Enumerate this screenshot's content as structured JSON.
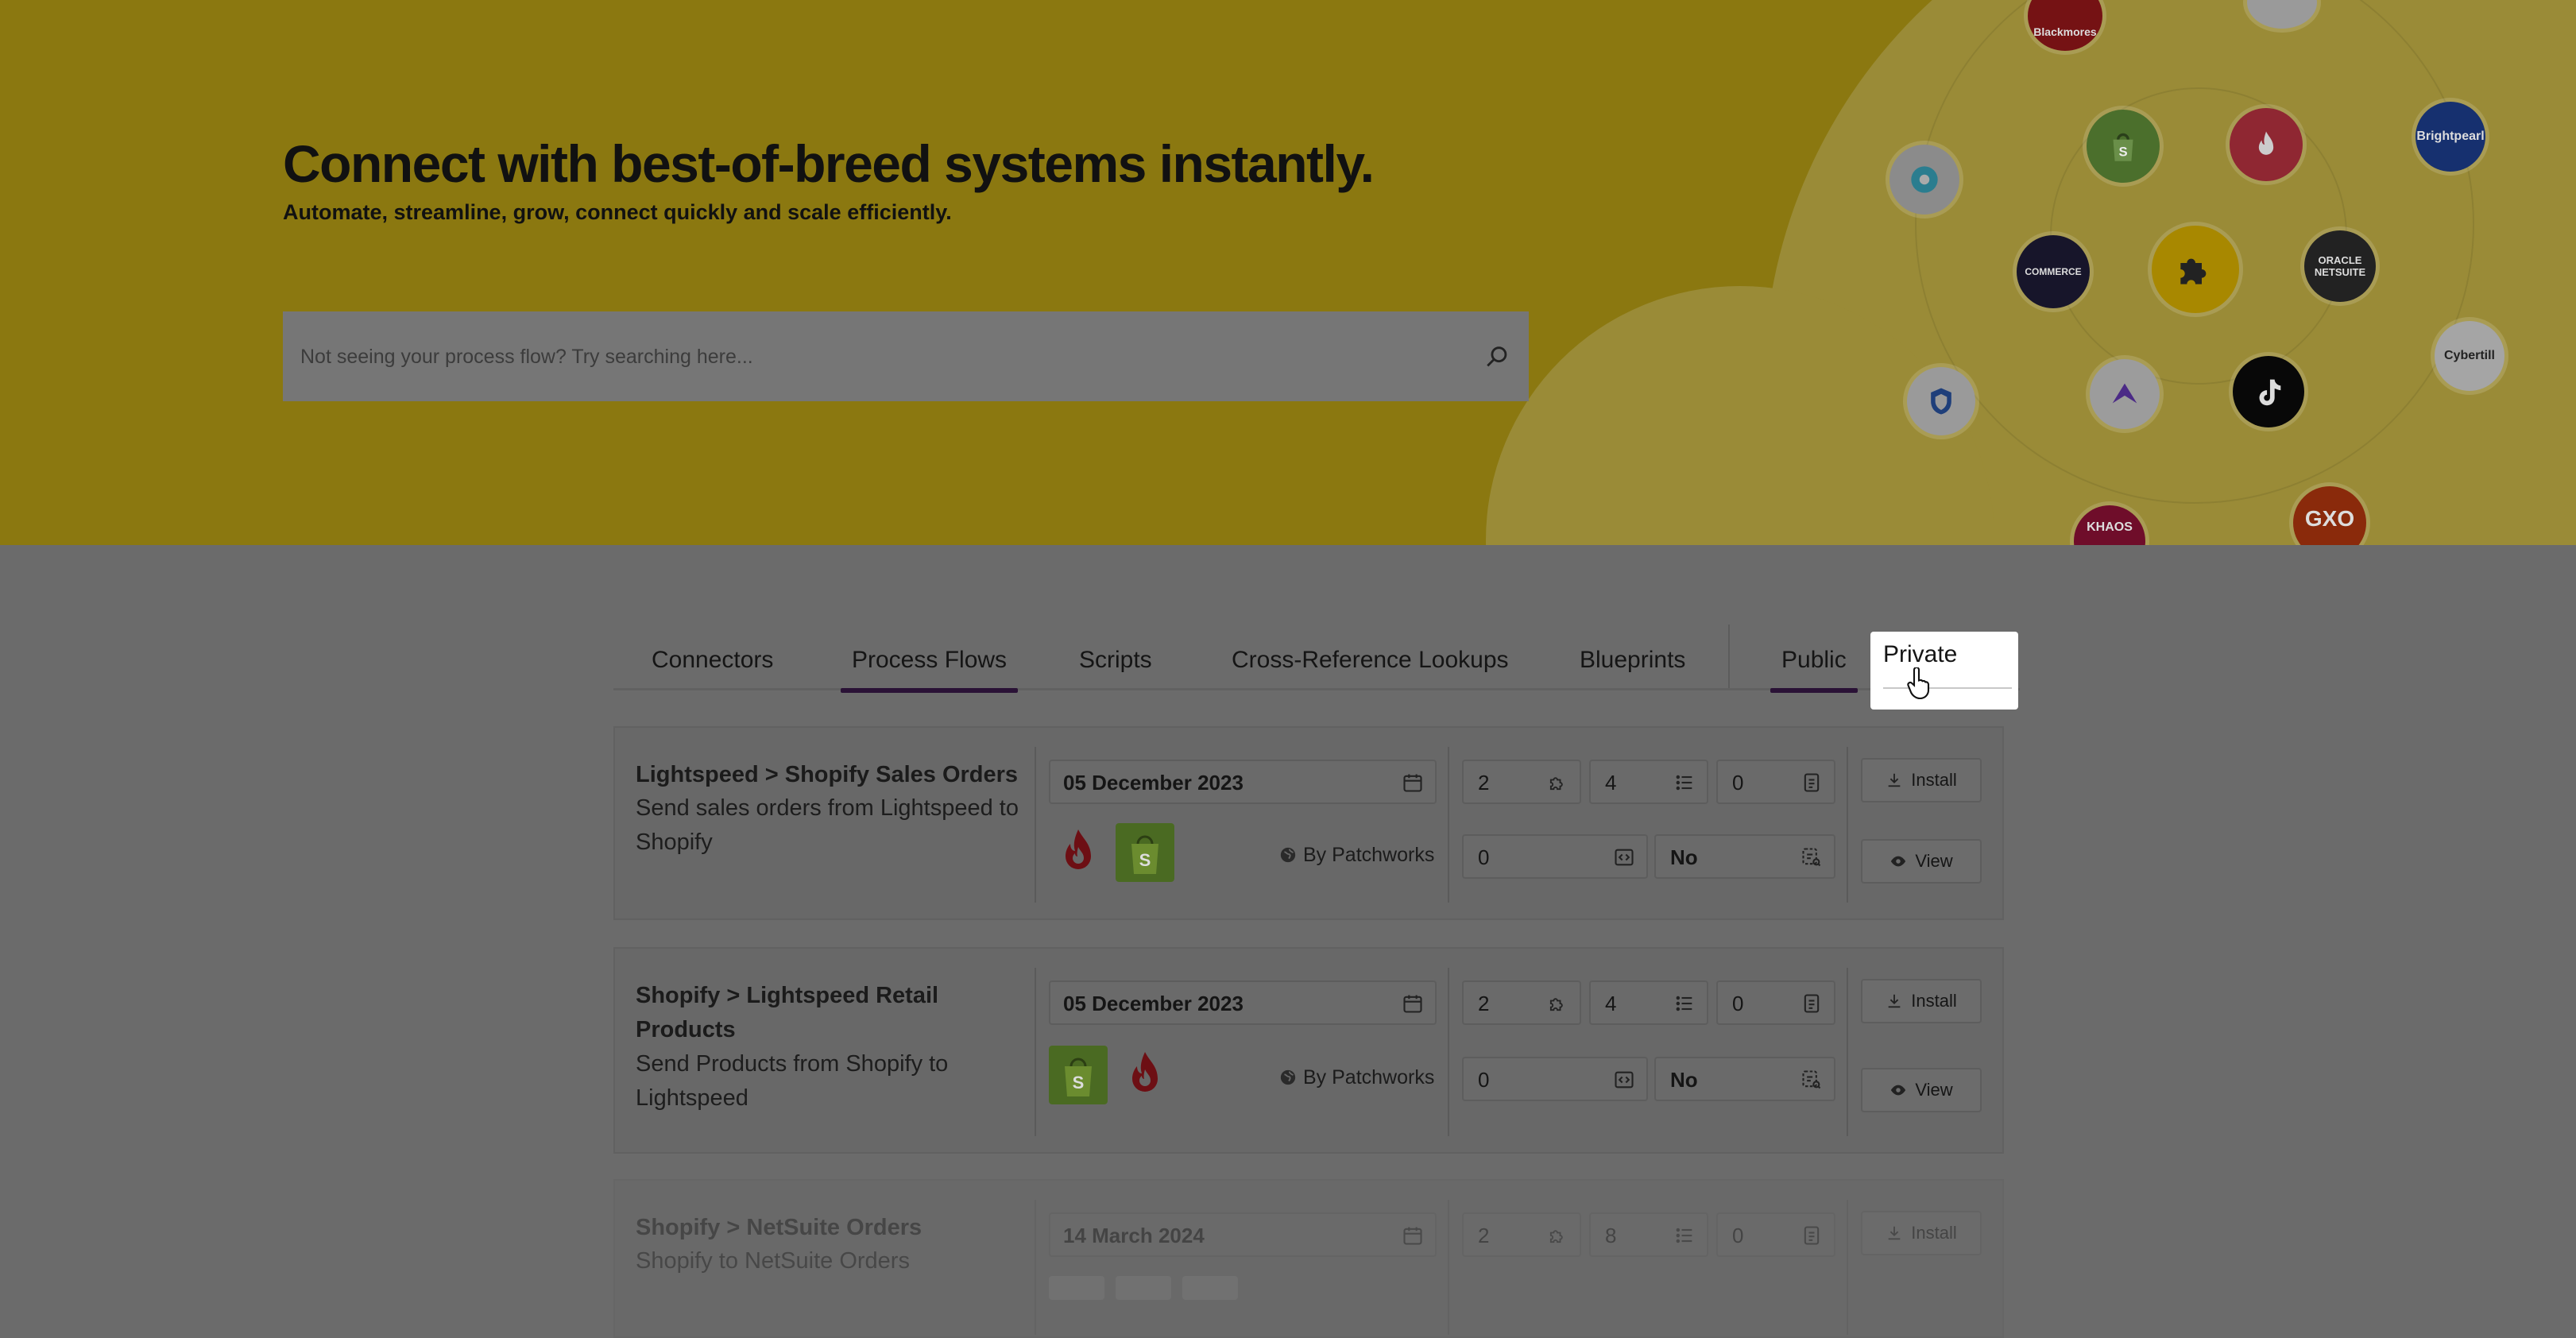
{
  "hero": {
    "title": "Connect with best-of-breed systems instantly.",
    "subtitle": "Automate, streamline, grow, connect quickly and scale efficiently.",
    "search_placeholder": "Not seeing your process flow? Try searching here...",
    "logos": [
      {
        "name": "blackmores-logo",
        "label": "Blackmores",
        "color": "#a3151b"
      },
      {
        "name": "shopify-logo",
        "label": "",
        "color": "#5e8e3e"
      },
      {
        "name": "lightspeed-logo",
        "label": "",
        "color": "#b73240"
      },
      {
        "name": "brightpearl-logo",
        "label": "Brightpearl",
        "color": "#1d3b8f"
      },
      {
        "name": "bigcommerce-logo",
        "label": "COMMERCE",
        "color": "#1d1b2e"
      },
      {
        "name": "patchworks-logo",
        "label": "",
        "color": "#c9a200"
      },
      {
        "name": "oracle-netsuite-logo",
        "label": "ORACLE NETSUITE",
        "color": "#2b2b2b"
      },
      {
        "name": "cybertill-logo",
        "label": "Cybertill",
        "color": "#dcdcdc"
      },
      {
        "name": "tiktok-logo",
        "label": "",
        "color": "#0b0b0b"
      },
      {
        "name": "khaos-logo",
        "label": "KHAOS",
        "color": "#a0123b"
      },
      {
        "name": "gxo-logo",
        "label": "GXO",
        "color": "#c13a10"
      }
    ]
  },
  "tabs": {
    "items": [
      "Connectors",
      "Process Flows",
      "Scripts",
      "Cross-Reference Lookups",
      "Blueprints"
    ],
    "visibility": [
      "Public",
      "Private"
    ]
  },
  "flows": [
    {
      "title": "Lightspeed > Shopify Sales Orders",
      "description": "Send sales orders from Lightspeed to Shopify",
      "date": "05 December 2023",
      "author": "By Patchworks",
      "systems": [
        "lightspeed-logo",
        "shopify-logo"
      ],
      "stat_connectors": "2",
      "stat_steps": "4",
      "stat_variables": "0",
      "stat_scripts": "0",
      "stat_cross_ref": "No",
      "install_label": "Install",
      "view_label": "View"
    },
    {
      "title": "Shopify > Lightspeed Retail Products",
      "description": "Send Products from Shopify to Lightspeed",
      "date": "05 December 2023",
      "author": "By Patchworks",
      "systems": [
        "shopify-logo",
        "lightspeed-logo"
      ],
      "stat_connectors": "2",
      "stat_steps": "4",
      "stat_variables": "0",
      "stat_scripts": "0",
      "stat_cross_ref": "No",
      "install_label": "Install",
      "view_label": "View"
    },
    {
      "title": "Shopify > NetSuite Orders",
      "description": "Shopify to NetSuite Orders",
      "date": "14 March 2024",
      "stat_connectors": "2",
      "stat_steps": "8",
      "stat_variables": "0",
      "install_label": "Install"
    }
  ]
}
